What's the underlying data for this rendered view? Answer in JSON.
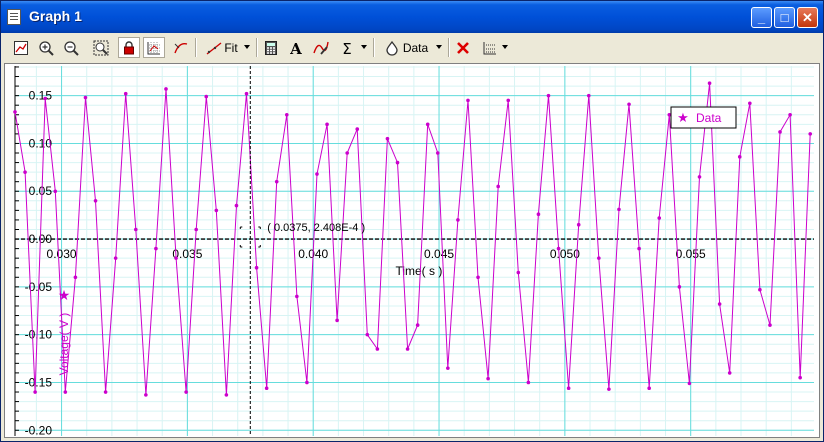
{
  "window": {
    "title": "Graph 1"
  },
  "toolbar": {
    "fit_label": "Fit",
    "data_label": "Data"
  },
  "icons": [
    "graph-options-icon",
    "zoom-in-icon",
    "zoom-out-icon",
    "autoscale-icon",
    "lock-icon",
    "grid-icon",
    "smooth-icon",
    "fit-icon",
    "calculator-icon",
    "text-icon",
    "curve-icon",
    "sigma-icon",
    "data-set-icon",
    "delete-icon",
    "graph-layout-icon"
  ],
  "colors": {
    "series": "#cc00cc",
    "grid": "#66dddd",
    "minor_grid": "#d8f4f4",
    "axis": "#000000",
    "title_bar": "#0050d8"
  },
  "cursor": {
    "label": "( 0.0375, 2.408E-4 )"
  },
  "legend": {
    "label": "Data"
  },
  "chart_data": {
    "type": "line",
    "xlabel": "Time( s )",
    "ylabel": "Voltage( V )",
    "xlim": [
      0.02815,
      0.0599
    ],
    "ylim": [
      -0.206,
      0.181
    ],
    "xticks": [
      "0.030",
      "0.035",
      "0.040",
      "0.045",
      "0.050",
      "0.055"
    ],
    "xtick_values": [
      0.03,
      0.035,
      0.04,
      0.045,
      0.05,
      0.055
    ],
    "yticks": [
      "0.15",
      "0.10",
      "0.05",
      "0.00",
      "-0.05",
      "-0.10",
      "-0.15",
      "-0.20"
    ],
    "ytick_values": [
      0.15,
      0.1,
      0.05,
      0.0,
      -0.05,
      -0.1,
      -0.15,
      -0.2
    ],
    "series": [
      {
        "name": "Data",
        "marker": "dot",
        "x": [
          0.02815,
          0.02855,
          0.02895,
          0.02935,
          0.02975,
          0.03015,
          0.03055,
          0.03095,
          0.03135,
          0.03175,
          0.03215,
          0.03255,
          0.03295,
          0.03335,
          0.03375,
          0.03415,
          0.03455,
          0.03495,
          0.03535,
          0.03575,
          0.03615,
          0.03655,
          0.03695,
          0.03735,
          0.03775,
          0.03815,
          0.03855,
          0.03895,
          0.03935,
          0.03975,
          0.04015,
          0.04055,
          0.04095,
          0.04135,
          0.04175,
          0.04215,
          0.04255,
          0.04295,
          0.04335,
          0.04375,
          0.04415,
          0.04455,
          0.04495,
          0.04535,
          0.04575,
          0.04615,
          0.04655,
          0.04695,
          0.04735,
          0.04775,
          0.04815,
          0.04855,
          0.04895,
          0.04935,
          0.04975,
          0.05015,
          0.05055,
          0.05095,
          0.05135,
          0.05175,
          0.05215,
          0.05255,
          0.05295,
          0.05335,
          0.05375,
          0.05415,
          0.05455,
          0.05495,
          0.05535,
          0.05575,
          0.05615,
          0.05655,
          0.05695,
          0.05735,
          0.05775,
          0.05815,
          0.05855,
          0.05895,
          0.05935,
          0.05975
        ],
        "y": [
          0.133,
          0.07,
          -0.16,
          0.147,
          0.05,
          -0.16,
          -0.04,
          0.148,
          0.04,
          -0.16,
          -0.02,
          0.152,
          0.01,
          -0.163,
          -0.01,
          0.157,
          -0.02,
          -0.16,
          0.01,
          0.149,
          0.03,
          -0.163,
          0.035,
          0.152,
          -0.03,
          -0.156,
          0.06,
          0.13,
          -0.06,
          -0.15,
          0.068,
          0.12,
          -0.085,
          0.09,
          0.115,
          -0.1,
          -0.115,
          0.105,
          0.08,
          -0.115,
          -0.09,
          0.12,
          0.09,
          -0.135,
          0.02,
          0.145,
          -0.04,
          -0.146,
          0.055,
          0.145,
          -0.035,
          -0.15,
          0.026,
          0.15,
          -0.01,
          -0.156,
          0.015,
          0.15,
          -0.02,
          -0.157,
          0.031,
          0.141,
          -0.01,
          -0.156,
          0.022,
          0.13,
          -0.05,
          -0.151,
          0.065,
          0.163,
          -0.068,
          -0.14,
          0.086,
          0.142,
          -0.053,
          -0.09,
          0.112,
          0.13,
          -0.145,
          0.11
        ]
      }
    ]
  }
}
